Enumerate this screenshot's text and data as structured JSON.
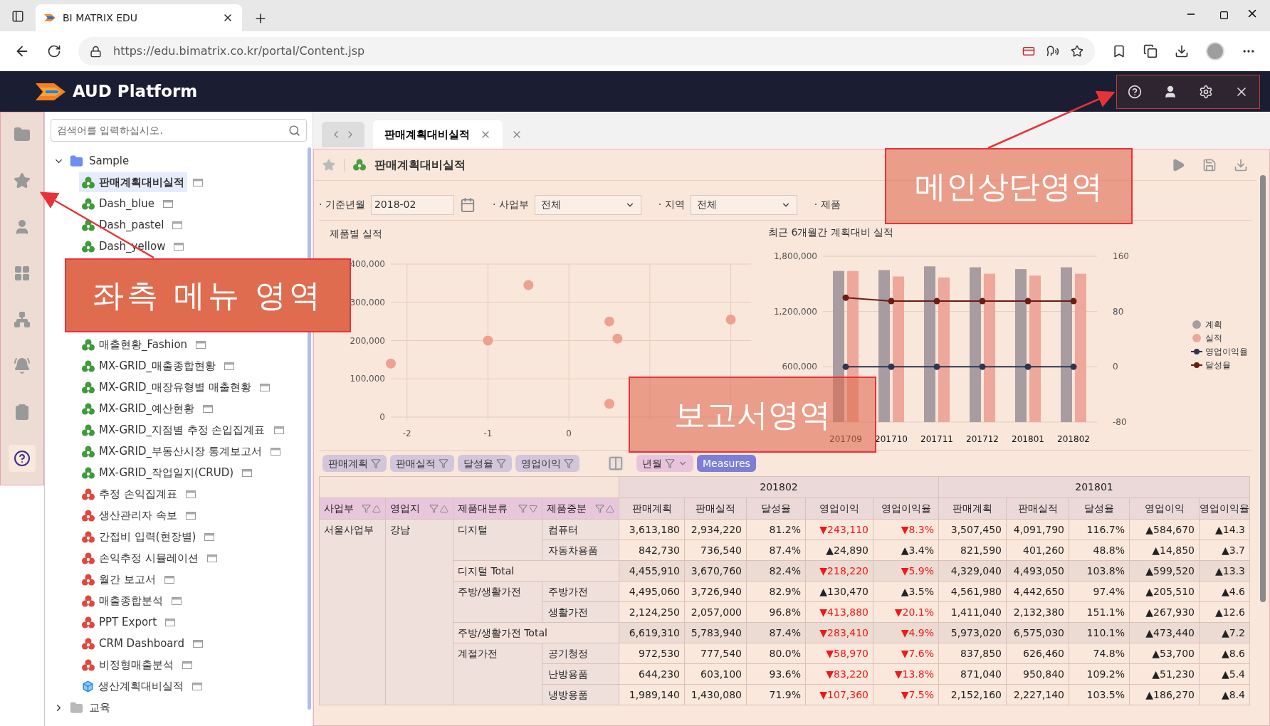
{
  "browser": {
    "tab_title": "BI MATRIX EDU",
    "url": "https://edu.bimatrix.co.kr/portal/Content.jsp"
  },
  "app": {
    "title": "AUD Platform"
  },
  "sidebar": {
    "rail": [
      {
        "kind": "folder",
        "selected": false
      },
      {
        "kind": "star",
        "selected": false
      },
      {
        "kind": "user",
        "selected": false
      },
      {
        "kind": "grid",
        "selected": false
      },
      {
        "kind": "tree",
        "selected": false
      },
      {
        "kind": "bell",
        "selected": false
      },
      {
        "kind": "clipboard",
        "selected": false
      },
      {
        "kind": "help",
        "selected": true
      }
    ],
    "search": {
      "placeholder": "검색어를 입력하십시오."
    },
    "tree": [
      {
        "label": "Sample",
        "expanded": true,
        "children": [
          {
            "label": "판매계획대비실적",
            "kind": "green",
            "selected": true
          },
          {
            "label": "Dash_blue",
            "kind": "green",
            "selected": false
          },
          {
            "label": "Dash_pastel",
            "kind": "green",
            "selected": false
          },
          {
            "label": "Dash_yellow",
            "kind": "green",
            "selected": false
          },
          {
            "label": "좌측 메뉴 영역",
            "kind": "annotation"
          },
          {
            "label": "매출현황_Fashion",
            "kind": "green",
            "selected": false
          },
          {
            "label": "MX-GRID_매출종합현황",
            "kind": "green",
            "selected": false
          },
          {
            "label": "MX-GRID_매장유형별 매출현황",
            "kind": "green",
            "selected": false
          },
          {
            "label": "MX-GRID_예산현황",
            "kind": "green",
            "selected": false
          },
          {
            "label": "MX-GRID_지점별 추정 손입집계표",
            "kind": "green",
            "selected": false
          },
          {
            "label": "MX-GRID_부동산시장 통계보고서",
            "kind": "green",
            "selected": false
          },
          {
            "label": "MX-GRID_작업일지(CRUD)",
            "kind": "green",
            "selected": false
          },
          {
            "label": "추정 손익집계표",
            "kind": "red",
            "selected": false
          },
          {
            "label": "생산관리자 속보",
            "kind": "red",
            "selected": false
          },
          {
            "label": "간접비 입력(현장별)",
            "kind": "red",
            "selected": false
          },
          {
            "label": "손익추정 시뮬레이션",
            "kind": "red",
            "selected": false
          },
          {
            "label": "월간 보고서",
            "kind": "red",
            "selected": false
          },
          {
            "label": "매출종합분석",
            "kind": "red",
            "selected": false
          },
          {
            "label": "PPT Export",
            "kind": "red",
            "selected": false
          },
          {
            "label": "CRM Dashboard",
            "kind": "red",
            "selected": false
          },
          {
            "label": "비정형매출분석",
            "kind": "red",
            "selected": false
          },
          {
            "label": "생산계획대비실적",
            "kind": "cube",
            "selected": false
          }
        ]
      },
      {
        "label": "교육",
        "expanded": false
      }
    ]
  },
  "tabs": [
    {
      "label": "판매계획대비실적",
      "selected": true
    }
  ],
  "report": {
    "title": "판매계획대비실적",
    "filters": [
      {
        "kind": "date",
        "label": "· 기준년월",
        "value": "2018-02"
      },
      {
        "kind": "select",
        "label": "· 사업부",
        "value": "전체"
      },
      {
        "kind": "select",
        "label": "· 지역",
        "value": "전체"
      },
      {
        "kind": "select",
        "label": "· 제품"
      }
    ],
    "scatter": {
      "chart_data": {
        "type": "scatter",
        "title": "제품별 실적",
        "grid": true,
        "xlim": [
          -2.2,
          2.25
        ],
        "ylim": [
          0,
          400000
        ],
        "xticks": [
          -2,
          -1,
          0
        ],
        "yticks": [
          {
            "value": 0,
            "label": "0"
          },
          {
            "value": 100000,
            "label": "100,000"
          },
          {
            "value": 200000,
            "label": "200,000"
          },
          {
            "value": 300000,
            "label": "300,000"
          },
          {
            "value": 400000,
            "label": "400,000"
          }
        ],
        "series": [
          {
            "color": "#eea191",
            "x": [
              -2.2,
              -1,
              -0.5,
              0.5,
              0.6,
              0.5,
              2
            ],
            "values": [
              140000,
              200000,
              345000,
              250000,
              205000,
              35000,
              255000
            ]
          }
        ]
      }
    },
    "combo": {
      "chart_data": {
        "type": "bar",
        "title": "최근 6개월간 계획대비 실적",
        "grid": true,
        "categories": [
          "201709",
          "201710",
          "201711",
          "201712",
          "201801",
          "201802"
        ],
        "ylim": [
          0,
          1800000
        ],
        "yticks": [
          {
            "value": 600000,
            "label": "600,000"
          },
          {
            "value": 1200000,
            "label": "1,200,000"
          },
          {
            "value": 1800000,
            "label": "1,800,000"
          }
        ],
        "series": [
          {
            "name": "계획",
            "type": "bar",
            "color": "#a89ca0",
            "values": [
              1640000,
              1650000,
              1690000,
              1680000,
              1660000,
              1680000
            ]
          },
          {
            "name": "실적",
            "type": "bar",
            "color": "#eea89b",
            "values": [
              1640000,
              1580000,
              1570000,
              1610000,
              1590000,
              1610000
            ]
          }
        ]
      }
    },
    "combo_lines": {
      "chart_data": {
        "type": "line",
        "ylim": [
          -80,
          160
        ],
        "yticks": [
          -80,
          0,
          80,
          160
        ],
        "series": [
          {
            "name": "영업이익율",
            "color": "#2e3550",
            "marker": "o",
            "values": [
              0,
              0,
              0,
              0,
              0,
              0
            ]
          },
          {
            "name": "달성율",
            "color": "#6b1d12",
            "marker": "o",
            "values": [
              100,
              95,
              95,
              95,
              95,
              95
            ]
          }
        ]
      }
    }
  },
  "pivot": {
    "fields": [
      {
        "label": "판매계획",
        "kind": "measure"
      },
      {
        "label": "판매실적",
        "kind": "measure"
      },
      {
        "label": "달성율",
        "kind": "measure"
      },
      {
        "label": "영업이익",
        "kind": "measure"
      },
      {
        "label": "년월",
        "kind": "column"
      },
      {
        "label": "Measures",
        "kind": "measures"
      }
    ],
    "dims": [
      {
        "label": "사업부",
        "ascending": true
      },
      {
        "label": "영업지",
        "ascending": true
      },
      {
        "label": "제품대분류",
        "ascending": false
      },
      {
        "label": "제품중분",
        "ascending": true
      }
    ],
    "periods": [
      {
        "label": "201802",
        "measures": [
          "판매계획",
          "판매실적",
          "달성율",
          "영업이익",
          "영업이익율"
        ]
      },
      {
        "label": "201801",
        "measures": [
          "판매계획",
          "판매실적",
          "달성율",
          "영업이익",
          "영업이익율"
        ]
      }
    ],
    "division": "서울사업부",
    "region": "강남",
    "categories": [
      {
        "name": "디지털",
        "items": [
          {
            "name": "컴퓨터",
            "cells": [
              [
                "3,613,180",
                "2,934,220",
                "81.2%",
                "▼243,110",
                "▼8.3%"
              ],
              [
                "3,507,450",
                "4,091,790",
                "116.7%",
                "▲584,670",
                "▲14.3"
              ]
            ],
            "down": [
              true,
              false
            ]
          },
          {
            "name": "자동차용품",
            "cells": [
              [
                "842,730",
                "736,540",
                "87.4%",
                "▲24,890",
                "▲3.4%"
              ],
              [
                "821,590",
                "401,260",
                "48.8%",
                "▲14,850",
                "▲3.7"
              ]
            ],
            "down": [
              false,
              false
            ]
          }
        ],
        "total": {
          "label": "디지털 Total",
          "cells": [
            [
              "4,455,910",
              "3,670,760",
              "82.4%",
              "▼218,220",
              "▼5.9%"
            ],
            [
              "4,329,040",
              "4,493,050",
              "103.8%",
              "▲599,520",
              "▲13.3"
            ]
          ],
          "down": [
            true,
            false
          ]
        }
      },
      {
        "name": "주방/생활가전",
        "items": [
          {
            "name": "주방가전",
            "cells": [
              [
                "4,495,060",
                "3,726,940",
                "82.9%",
                "▲130,470",
                "▲3.5%"
              ],
              [
                "4,561,980",
                "4,442,650",
                "97.4%",
                "▲205,510",
                "▲4.6"
              ]
            ],
            "down": [
              false,
              false
            ]
          },
          {
            "name": "생활가전",
            "cells": [
              [
                "2,124,250",
                "2,057,000",
                "96.8%",
                "▼413,880",
                "▼20.1%"
              ],
              [
                "1,411,040",
                "2,132,380",
                "151.1%",
                "▲267,930",
                "▲12.6"
              ]
            ],
            "down": [
              true,
              false
            ]
          }
        ],
        "total": {
          "label": "주방/생활가전 Total",
          "cells": [
            [
              "6,619,310",
              "5,783,940",
              "87.4%",
              "▼283,410",
              "▼4.9%"
            ],
            [
              "5,973,020",
              "6,575,030",
              "110.1%",
              "▲473,440",
              "▲7.2"
            ]
          ],
          "down": [
            true,
            false
          ]
        }
      },
      {
        "name": "계절가전",
        "items": [
          {
            "name": "공기청정",
            "cells": [
              [
                "972,530",
                "777,540",
                "80.0%",
                "▼58,970",
                "▼7.6%"
              ],
              [
                "837,850",
                "626,460",
                "74.8%",
                "▲53,700",
                "▲8.6"
              ]
            ],
            "down": [
              true,
              false
            ]
          },
          {
            "name": "난방용품",
            "cells": [
              [
                "644,230",
                "603,100",
                "93.6%",
                "▼83,220",
                "▼13.8%"
              ],
              [
                "871,040",
                "950,840",
                "109.2%",
                "▲51,230",
                "▲5.4"
              ]
            ],
            "down": [
              true,
              false
            ]
          },
          {
            "name": "냉방용품",
            "cells": [
              [
                "1,989,140",
                "1,430,080",
                "71.9%",
                "▼107,360",
                "▼7.5%"
              ],
              [
                "2,152,160",
                "2,227,140",
                "103.5%",
                "▲186,270",
                "▲8.4"
              ]
            ],
            "down": [
              true,
              false
            ]
          }
        ]
      }
    ]
  },
  "annotations": [
    {
      "kind": "top",
      "label": "메인상단영역"
    },
    {
      "kind": "report",
      "label": "보고서영역"
    }
  ]
}
